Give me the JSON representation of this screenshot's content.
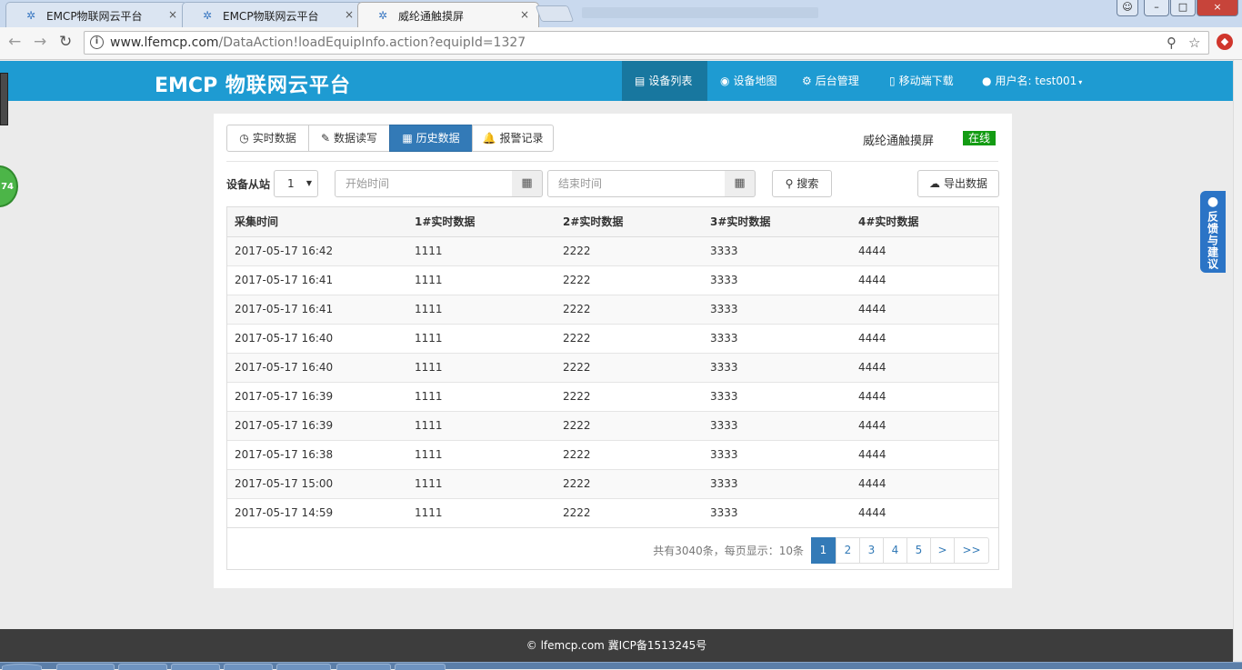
{
  "browser": {
    "tabs": [
      {
        "title": "EMCP物联网云平台",
        "active": false
      },
      {
        "title": "EMCP物联网云平台",
        "active": false
      },
      {
        "title": "威纶通触摸屏",
        "active": true
      }
    ],
    "tab_close_glyph": "×",
    "url_host": "www.lfemcp.com",
    "url_path": "/DataAction!loadEquipInfo.action?equipId=1327",
    "window_controls": {
      "minimize": "–",
      "maximize": "□",
      "close": "×"
    }
  },
  "header": {
    "brand_logo": "EMCP",
    "brand_text": "物联网云平台",
    "nav": [
      {
        "label": "设备列表",
        "icon": "list-icon",
        "active": true
      },
      {
        "label": "设备地图",
        "icon": "globe-icon",
        "active": false
      },
      {
        "label": "后台管理",
        "icon": "cogs-icon",
        "active": false
      },
      {
        "label": "移动端下载",
        "icon": "mobile-icon",
        "active": false
      },
      {
        "label": "用户名: test001",
        "icon": "user-icon",
        "active": false
      }
    ]
  },
  "left_widget": {
    "badge": "74"
  },
  "feedback": {
    "label": "反馈与建议"
  },
  "panel": {
    "tabs": [
      {
        "label": "实时数据",
        "icon": "clock-icon",
        "active": false
      },
      {
        "label": "数据读写",
        "icon": "pencil-icon",
        "active": false
      },
      {
        "label": "历史数据",
        "icon": "table-icon",
        "active": true
      },
      {
        "label": "报警记录",
        "icon": "bell-icon",
        "active": false
      }
    ],
    "device_name": "威纶通触摸屏",
    "status": "在线",
    "status_color": "#139b13",
    "filter": {
      "slave_label": "设备从站",
      "slave_value": "1",
      "start_placeholder": "开始时间",
      "end_placeholder": "结束时间",
      "search_label": "搜索",
      "export_label": "导出数据"
    },
    "table": {
      "columns": [
        "采集时间",
        "1#实时数据",
        "2#实时数据",
        "3#实时数据",
        "4#实时数据"
      ],
      "rows": [
        [
          "2017-05-17 16:42",
          "1111",
          "2222",
          "3333",
          "4444"
        ],
        [
          "2017-05-17 16:41",
          "1111",
          "2222",
          "3333",
          "4444"
        ],
        [
          "2017-05-17 16:41",
          "1111",
          "2222",
          "3333",
          "4444"
        ],
        [
          "2017-05-17 16:40",
          "1111",
          "2222",
          "3333",
          "4444"
        ],
        [
          "2017-05-17 16:40",
          "1111",
          "2222",
          "3333",
          "4444"
        ],
        [
          "2017-05-17 16:39",
          "1111",
          "2222",
          "3333",
          "4444"
        ],
        [
          "2017-05-17 16:39",
          "1111",
          "2222",
          "3333",
          "4444"
        ],
        [
          "2017-05-17 16:38",
          "1111",
          "2222",
          "3333",
          "4444"
        ],
        [
          "2017-05-17 15:00",
          "1111",
          "2222",
          "3333",
          "4444"
        ],
        [
          "2017-05-17 14:59",
          "1111",
          "2222",
          "3333",
          "4444"
        ]
      ]
    },
    "pagination": {
      "summary": "共有3040条，每页显示：10条",
      "pages": [
        "1",
        "2",
        "3",
        "4",
        "5",
        ">",
        ">>"
      ],
      "current": "1"
    }
  },
  "footer": {
    "text": "lfemcp.com 冀ICP备1513245号"
  },
  "colors": {
    "header_bg": "#1e9bd2",
    "nav_active": "#18779f",
    "primary": "#337ab7",
    "footer_bg": "#3d3d3d"
  }
}
